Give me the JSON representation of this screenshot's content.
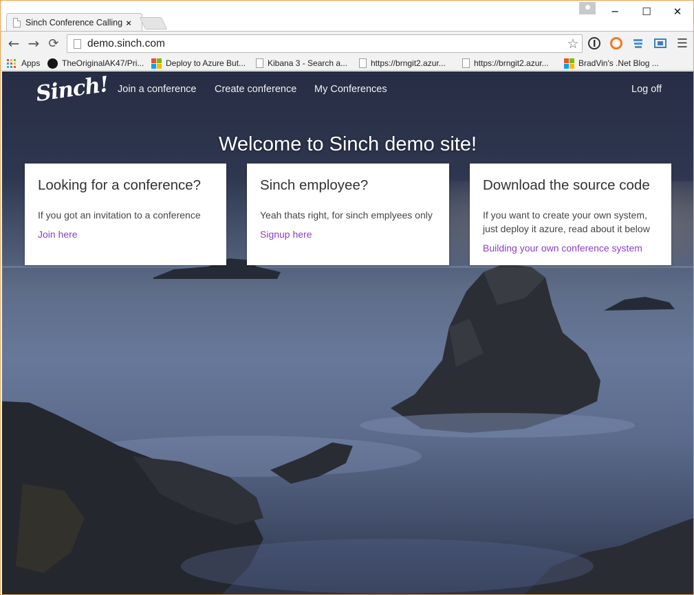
{
  "browser": {
    "tab_title": "Sinch Conference Calling",
    "tab_close": "×",
    "url": "demo.sinch.com",
    "window_controls": {
      "minimize": "─",
      "maximize": "☐",
      "close": "✕"
    },
    "nav": {
      "back": "←",
      "forward": "→",
      "reload": "⟳"
    },
    "bookmarks": [
      {
        "label": "Apps",
        "icon": "apps-grid-icon"
      },
      {
        "label": "TheOriginalAK47/Pri...",
        "icon": "github-icon"
      },
      {
        "label": "Deploy to Azure But...",
        "icon": "microsoft-icon"
      },
      {
        "label": "Kibana 3 - Search a...",
        "icon": "page-icon"
      },
      {
        "label": "https://brngit2.azur...",
        "icon": "page-icon"
      },
      {
        "label": "https://brngit2.azur...",
        "icon": "page-icon"
      },
      {
        "label": "BradVin's .Net Blog ...",
        "icon": "microsoft-icon"
      }
    ]
  },
  "site": {
    "logo": "Sinch!",
    "nav": {
      "join": "Join a conference",
      "create": "Create conference",
      "mine": "My Conferences",
      "logoff": "Log off"
    },
    "headline": "Welcome to Sinch demo site!",
    "cards": [
      {
        "title": "Looking for a conference?",
        "text": "If you got an invitation to a conference",
        "link": "Join here"
      },
      {
        "title": "Sinch employee?",
        "text": "Yeah thats right, for sinch emplyees only",
        "link": "Signup here"
      },
      {
        "title": "Download the source code",
        "text": "If you want to create your own system, just deploy it azure, read about it below",
        "link": "Building your own conference system"
      }
    ]
  },
  "colors": {
    "link": "#8e3cc6",
    "accent_border": "#e8a24a"
  }
}
